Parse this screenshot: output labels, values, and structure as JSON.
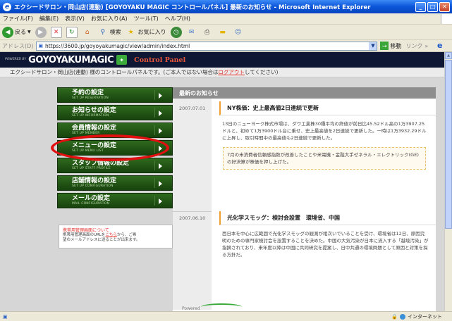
{
  "window": {
    "title": "エクシードサロン・岡山店(連動) [GOYOYAKU MAGIC コントロールパネル] 最新のお知らせ - Microsoft Internet Explorer"
  },
  "menubar": [
    "ファイル(F)",
    "編集(E)",
    "表示(V)",
    "お気に入り(A)",
    "ツール(T)",
    "ヘルプ(H)"
  ],
  "toolbar": {
    "back": "戻る",
    "search": "検索",
    "favorites": "お気に入り"
  },
  "address": {
    "label": "アドレス(D)",
    "url": "https://3600.jp/goyoyakumagic/view/admin/index.html",
    "go": "移動",
    "links": "リンク"
  },
  "header": {
    "powered": "POWERED BY",
    "brand": "GOYOYAKUMAGIC",
    "panel": "Control Panel",
    "notice_prefix": "エクシードサロン・岡山店(連動) 様のコントロールパネルです。(ご本人ではない場合は",
    "logout": "ログアウト",
    "notice_suffix": "してください)"
  },
  "sidebar": {
    "items": [
      {
        "jp": "予約の設定",
        "en": "SET UP RESERVATION"
      },
      {
        "jp": "お知らせの設定",
        "en": "SET UP INFORMATION"
      },
      {
        "jp": "会員情報の設定",
        "en": "SET UP MEMBER"
      },
      {
        "jp": "メニューの設定",
        "en": "SET UP MENU LIST"
      },
      {
        "jp": "スタッフ情報の設定",
        "en": "SET UP STAFF PROFILE"
      },
      {
        "jp": "店舗情報の設定",
        "en": "SET UP CONFIGURATION"
      },
      {
        "jp": "メールの設定",
        "en": "MAIL CONFIGURATION"
      }
    ],
    "note": {
      "title": "携帯用管理画面について",
      "line1_prefix": "携帯用管理画面のURLを",
      "line1_link": "こちら",
      "line1_suffix": "から、ご希",
      "line2": "望のメールアドレスに送ることが出来ます。"
    }
  },
  "main": {
    "heading": "最新のお知らせ",
    "articles": [
      {
        "date": "2007.07.01",
        "title": "NY株価：史上最高値2日連続で更新",
        "body": "13日のニューヨーク株式市場は、ダウ工業株30種平均の終値が前日比45.52ドル高の1万3907.25ドルと、初めて1万3900ドル台に乗せ、史上最高値を2日連続で更新した。一時は1万3932.29ドルに上昇し、取引時間中の最高値も2日連続で更新した。",
        "quote": "7月の米消費者信頼感指数が改善したことや米電機・金融大手ゼネラル・エレクトリック(GE)の好決算が株価を押し上げた。"
      },
      {
        "date": "2007.06.10",
        "title": "光化学スモッグ：検討会設置　環境省、中国",
        "body": "西日本を中心に広範囲で光化学スモッグの観測が相次いでいることを受け、環境省は12日、原因究明のための専門家検討会を設置することを決めた。中国の大気汚染が日本に流入する「越境汚染」が指摘されており、来年度以降は中国に共同研究を提案し、日中共通の環境問題として原因と対策を探る方針だ。"
      }
    ]
  },
  "footer": {
    "powered": "Powered"
  },
  "status": {
    "zone": "インターネット"
  }
}
